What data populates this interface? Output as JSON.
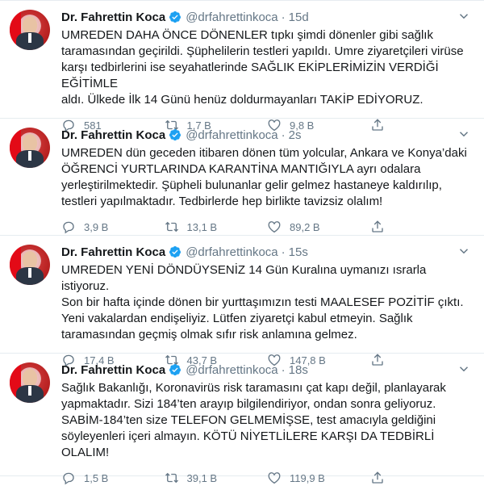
{
  "tweets": [
    {
      "name": "Dr. Fahrettin Koca",
      "handle": "@drfahrettinkoca",
      "time": "15d",
      "text": "UMREDEN DAHA ÖNCE DÖNENLER tıpkı şimdi dönenler gibi sağlık\ntaramasından geçirildi. Şüphelilerin testleri yapıldı. Umre ziyaretçileri virüse\nkarşı tedbirlerini ise seyahatlerinde SAĞLIK EKİPLERİMİZİN VERDİĞİ EĞİTİMLE\naldı. Ülkede İlk 14 Günü henüz doldurmayanları TAKİP EDİYORUZ.",
      "replies": "581",
      "retweets": "1,7 B",
      "likes": "9,8 B"
    },
    {
      "name": "Dr. Fahrettin Koca",
      "handle": "@drfahrettinkoca",
      "time": "2s",
      "text": "UMREDEN dün geceden itibaren dönen tüm yolcular, Ankara ve Konya’daki\nÖĞRENCİ YURTLARINDA KARANTİNA MANTIĞIYLA ayrı odalara\nyerleştirilmektedir. Şüpheli bulunanlar gelir gelmez hastaneye kaldırılıp,\ntestleri yapılmaktadır. Tedbirlerde hep birlikte tavizsiz olalım!",
      "replies": "3,9 B",
      "retweets": "13,1 B",
      "likes": "89,2 B"
    },
    {
      "name": "Dr. Fahrettin Koca",
      "handle": "@drfahrettinkoca",
      "time": "15s",
      "text": "UMREDEN YENİ DÖNDÜYSENİZ 14 Gün Kuralına uymanızı ısrarla istiyoruz.\nSon bir hafta içinde dönen bir yurttaşımızın testi MAALESEF POZİTİF çıktı.\nYeni vakalardan endişeliyiz. Lütfen ziyaretçi kabul etmeyin. Sağlık\ntaramasından geçmiş olmak sıfır risk anlamına gelmez.",
      "replies": "17,4 B",
      "retweets": "43,7 B",
      "likes": "147,8 B"
    },
    {
      "name": "Dr. Fahrettin Koca",
      "handle": "@drfahrettinkoca",
      "time": "18s",
      "text": "Sağlık Bakanlığı, Koronavirüs risk taramasını çat kapı değil, planlayarak\nyapmaktadır. Sizi 184’ten arayıp bilgilendiriyor, ondan sonra geliyoruz.\nSABİM-184’ten size TELEFON GELMEMİŞSE, test amacıyla geldiğini\nsöyleyenleri içeri almayın. KÖTÜ NİYETLİLERE KARŞI DA TEDBİRLİ OLALIM!",
      "replies": "1,5 B",
      "retweets": "39,1 B",
      "likes": "119,9 B"
    }
  ],
  "dot": "·",
  "icons": {
    "verified": "verified-badge-icon",
    "caret": "chevron-down-icon",
    "reply": "reply-icon",
    "retweet": "retweet-icon",
    "like": "heart-icon",
    "share": "share-icon"
  },
  "colors": {
    "verified": "#1da1f2",
    "secondary": "#657786",
    "border": "#e6ecf0"
  }
}
